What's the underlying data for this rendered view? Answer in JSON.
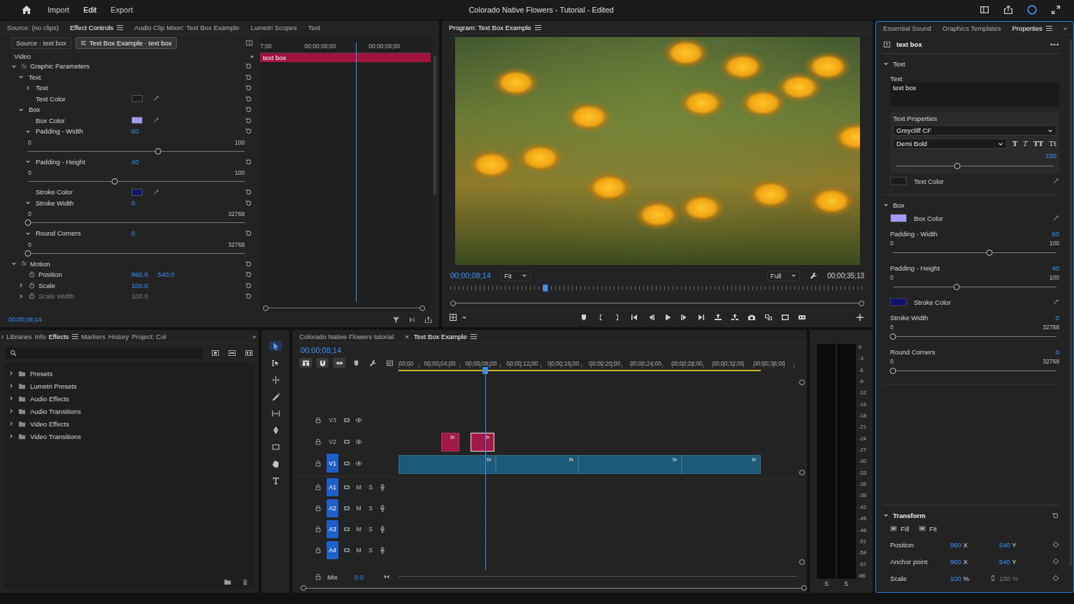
{
  "header": {
    "menu": [
      {
        "label": "Import",
        "selected": false
      },
      {
        "label": "Edit",
        "selected": true
      },
      {
        "label": "Export",
        "selected": false
      }
    ],
    "title": "Colorado Native Flowers - Tutorial - Edited"
  },
  "effect_controls": {
    "tabs": [
      {
        "label": "Source: (no clips)",
        "selected": false,
        "menu": false
      },
      {
        "label": "Effect Controls",
        "selected": true,
        "menu": true
      },
      {
        "label": "Audio Clip Mixer: Text Box Example",
        "selected": false,
        "menu": false
      },
      {
        "label": "Lumetri Scopes",
        "selected": false,
        "menu": false
      },
      {
        "label": "Text",
        "selected": false,
        "menu": false
      }
    ],
    "clip_tabs": [
      {
        "label": "Source · text box",
        "selected": false
      },
      {
        "label": "Text Box Example · text box",
        "selected": true
      }
    ],
    "section": "Video",
    "rows": [
      {
        "kind": "fx",
        "depth": 0,
        "badge": "fx",
        "label": "Graphic Parameters",
        "expanded": true
      },
      {
        "kind": "group",
        "depth": 1,
        "label": "Text",
        "expanded": true
      },
      {
        "kind": "group",
        "depth": 2,
        "label": "Text",
        "expanded": false
      },
      {
        "kind": "color",
        "depth": 2,
        "label": "Text Color",
        "color": "#1c1c1c"
      },
      {
        "kind": "group",
        "depth": 1,
        "label": "Box",
        "expanded": true
      },
      {
        "kind": "color",
        "depth": 2,
        "label": "Box Color",
        "color": "#a09cf7"
      },
      {
        "kind": "value",
        "depth": 2,
        "label": "Padding - Width",
        "value": "60",
        "expanded": true
      },
      {
        "kind": "slider",
        "depth": 2,
        "min": "0",
        "max": "100",
        "level": 0.6
      },
      {
        "kind": "value",
        "depth": 2,
        "label": "Padding - Height",
        "value": "40",
        "expanded": true
      },
      {
        "kind": "slider",
        "depth": 2,
        "min": "0",
        "max": "100",
        "level": 0.4
      },
      {
        "kind": "color",
        "depth": 2,
        "label": "Stroke Color",
        "color": "#121270"
      },
      {
        "kind": "value",
        "depth": 2,
        "label": "Stroke Width",
        "value": "0",
        "expanded": true
      },
      {
        "kind": "slider",
        "depth": 2,
        "min": "0",
        "max": "32768",
        "level": 0
      },
      {
        "kind": "value",
        "depth": 2,
        "label": "Round Corners",
        "value": "0",
        "expanded": true
      },
      {
        "kind": "slider",
        "depth": 2,
        "min": "0",
        "max": "32768",
        "level": 0
      },
      {
        "kind": "fx",
        "depth": 0,
        "badge": "fx",
        "label": "Motion",
        "expanded": true
      },
      {
        "kind": "value",
        "depth": 1,
        "label": "Position",
        "value": "960.0",
        "value2": "540.0",
        "animated": false
      },
      {
        "kind": "value",
        "depth": 1,
        "label": "Scale",
        "value": "100.0",
        "expanded": false,
        "animated": false
      },
      {
        "kind": "value",
        "depth": 1,
        "label": "Scale Width",
        "value": "100.0",
        "expanded": false,
        "animated": false,
        "disabled": true
      }
    ],
    "ruler": [
      "7;00",
      "00;00;08;00",
      "00;00;09;00"
    ],
    "clip": "text box",
    "playhead": 0.56,
    "timecode": "00;00;08;14"
  },
  "program": {
    "title": "Program: Text Box Example",
    "timecode": "00;00;08;14",
    "zoom": "Fit",
    "quality": "Full",
    "duration": "00;00;35;13",
    "playhead": 0.23
  },
  "properties": {
    "tabs": [
      {
        "label": "Essential Sound",
        "selected": false,
        "menu": false
      },
      {
        "label": "Graphics Templates",
        "selected": false,
        "menu": false
      },
      {
        "label": "Properties",
        "selected": true,
        "menu": true
      }
    ],
    "overflow": "»",
    "clip": "text box",
    "more": "•••",
    "text": {
      "title": "Text",
      "expanded": true,
      "field_label": "Text",
      "field_value": "text box",
      "props_label": "Text Properties",
      "font": "Greycliff CF",
      "style": "Demi Bold",
      "style_buttons": [
        {
          "label": "T",
          "kind": "bold"
        },
        {
          "label": "T",
          "kind": "italic"
        },
        {
          "label": "TT",
          "kind": "caps"
        },
        {
          "label": "Tt",
          "kind": "small"
        }
      ],
      "size": "150",
      "size_level": 0.39,
      "color_label": "Text Color",
      "color": "#1c1c1c"
    },
    "box": {
      "title": "Box",
      "expanded": true,
      "rows": [
        {
          "kind": "color",
          "label": "Box Color",
          "color": "#a09cf7"
        },
        {
          "kind": "slider",
          "label": "Padding - Width",
          "value": "60",
          "min": "0",
          "max": "100",
          "level": 0.59
        },
        {
          "kind": "slider",
          "label": "Padding - Height",
          "value": "40",
          "min": "0",
          "max": "100",
          "level": 0.39
        },
        {
          "kind": "color",
          "label": "Stroke Color",
          "color": "#121270"
        },
        {
          "kind": "slider",
          "label": "Stroke Width",
          "value": "0",
          "min": "0",
          "max": "32768",
          "level": 0
        },
        {
          "kind": "slider",
          "label": "Round Corners",
          "value": "0",
          "min": "0",
          "max": "32768",
          "level": 0
        }
      ]
    },
    "transform": {
      "title": "Transform",
      "expanded": true,
      "fit_options": [
        {
          "label": "Fill"
        },
        {
          "label": "Fit"
        }
      ],
      "rows": [
        {
          "label": "Position",
          "x": "960",
          "x_unit": "X",
          "y": "540",
          "y_unit": "Y",
          "linked": false,
          "y_disabled": false
        },
        {
          "label": "Anchor point",
          "x": "960",
          "x_unit": "X",
          "y": "540",
          "y_unit": "Y",
          "linked": false,
          "y_disabled": false
        },
        {
          "label": "Scale",
          "x": "100",
          "x_unit": "%",
          "y": "100",
          "y_unit": "%",
          "linked": true,
          "y_disabled": true
        }
      ]
    }
  },
  "effects_panel": {
    "tabs": [
      {
        "label": "r",
        "selected": false,
        "menu": false
      },
      {
        "label": "Libraries",
        "selected": false,
        "menu": false
      },
      {
        "label": "Info",
        "selected": false,
        "menu": false
      },
      {
        "label": "Effects",
        "selected": true,
        "menu": true
      },
      {
        "label": "Markers",
        "selected": false,
        "menu": false
      },
      {
        "label": "History",
        "selected": false,
        "menu": false
      },
      {
        "label": "Project: Col",
        "selected": false,
        "menu": false
      }
    ],
    "overflow": "»",
    "folders": [
      {
        "label": "Presets",
        "expanded": false
      },
      {
        "label": "Lumetri Presets",
        "expanded": false
      },
      {
        "label": "Audio Effects",
        "expanded": false
      },
      {
        "label": "Audio Transitions",
        "expanded": false
      },
      {
        "label": "Video Effects",
        "expanded": false
      },
      {
        "label": "Video Transitions",
        "expanded": false
      }
    ]
  },
  "tools": [
    {
      "selected": true
    },
    {
      "selected": false
    },
    {
      "selected": false
    },
    {
      "selected": false
    },
    {
      "selected": false
    },
    {
      "selected": false
    },
    {
      "selected": false
    },
    {
      "selected": false
    },
    {
      "selected": false
    }
  ],
  "timeline": {
    "tabs": [
      {
        "label": "Colorado Native Flowers tutorial",
        "selected": false,
        "closable": false,
        "menu": false
      },
      {
        "label": "Text Box Example",
        "selected": true,
        "closable": true,
        "menu": true
      }
    ],
    "close_glyph": "×",
    "timecode": "00;00;08;14",
    "toolbar": [
      {
        "on": true
      },
      {
        "on": true
      },
      {
        "on": true
      },
      {
        "on": false
      },
      {
        "on": false
      },
      {
        "on": false
      }
    ],
    "view_seconds": 38.7,
    "playhead": 8.45,
    "ruler": [
      {
        "time": 0,
        "label": "00;00"
      },
      {
        "time": 4,
        "label": "00;00;04;00"
      },
      {
        "time": 8,
        "label": "00;00;08;00"
      },
      {
        "time": 12,
        "label": "00;00;12;00"
      },
      {
        "time": 16,
        "label": "00;00;16;00"
      },
      {
        "time": 20,
        "label": "00;00;20;00"
      },
      {
        "time": 24,
        "label": "00;00;24;00"
      },
      {
        "time": 28,
        "label": "00;00;28;00"
      },
      {
        "time": 32,
        "label": "00;00;32;00"
      },
      {
        "time": 36,
        "label": "00;00;36;00"
      }
    ],
    "work_area": {
      "start": 0,
      "end": 35.2
    },
    "video_tracks": [
      {
        "name": "V3",
        "targeted": false,
        "clips": []
      },
      {
        "name": "V2",
        "targeted": false,
        "clips": [
          {
            "start": 4.14,
            "end": 5.93,
            "badge": "fx",
            "color": "#a3194a",
            "selected": false
          },
          {
            "start": 6.97,
            "end": 9.31,
            "badge": "fx",
            "color": "#a3194a",
            "selected": true
          }
        ]
      },
      {
        "name": "V1",
        "targeted": true,
        "clips": [
          {
            "start": 0,
            "end": 9.45,
            "badge": "fx",
            "color": "#1b5a78",
            "selected": false
          },
          {
            "start": 9.45,
            "end": 17.45,
            "badge": "fx",
            "color": "#1b5a78",
            "selected": false
          },
          {
            "start": 17.45,
            "end": 27.5,
            "badge": "fx",
            "color": "#1b5a78",
            "selected": false
          },
          {
            "start": 27.5,
            "end": 35.2,
            "badge": "fx",
            "color": "#1b5a78",
            "selected": false
          }
        ]
      }
    ],
    "audio_tracks": [
      {
        "name": "A1",
        "targeted": true,
        "mute": "M",
        "solo": "S"
      },
      {
        "name": "A2",
        "targeted": true,
        "mute": "M",
        "solo": "S"
      },
      {
        "name": "A3",
        "targeted": true,
        "mute": "M",
        "solo": "S"
      },
      {
        "name": "A4",
        "targeted": true,
        "mute": "M",
        "solo": "S"
      }
    ],
    "mix": {
      "label": "Mix",
      "value": "0.0"
    }
  },
  "audio_meter": {
    "scale": [
      "0",
      "-3",
      "-6",
      "-9",
      "-12",
      "-15",
      "-18",
      "-21",
      "-24",
      "-27",
      "-30",
      "-33",
      "-36",
      "-39",
      "-42",
      "-45",
      "-48",
      "-51",
      "-54",
      "-57"
    ],
    "unit": "dB",
    "solo": [
      "S",
      "S"
    ]
  }
}
